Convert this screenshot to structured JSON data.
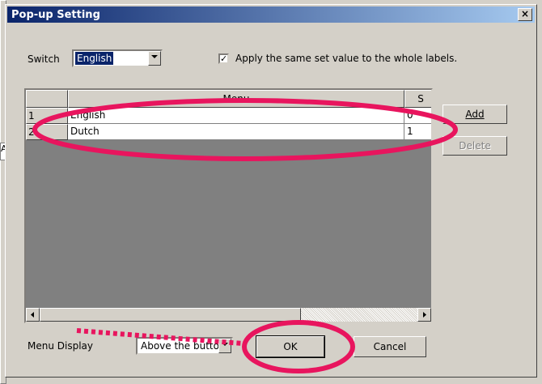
{
  "dialog": {
    "title": "Pop-up Setting",
    "close_glyph": "×"
  },
  "switch": {
    "label": "Switch",
    "value": "English"
  },
  "apply_all": {
    "checked": true,
    "check_glyph": "✓",
    "label": "Apply the same set value to the whole labels."
  },
  "grid": {
    "columns": [
      "",
      "Menu",
      "S"
    ],
    "rows": [
      {
        "num": "1",
        "menu": "English",
        "s": "0"
      },
      {
        "num": "2",
        "menu": "Dutch",
        "s": "1"
      }
    ]
  },
  "buttons": {
    "add": "Add",
    "delete": "Delete",
    "ok": "OK",
    "cancel": "Cancel"
  },
  "menu_display": {
    "label": "Menu Display",
    "value": "Above the button"
  },
  "background": {
    "fragment_text": "Ab"
  },
  "colors": {
    "annotation": "#e8155e",
    "title_start": "#0a246a",
    "title_end": "#a6caf0"
  }
}
